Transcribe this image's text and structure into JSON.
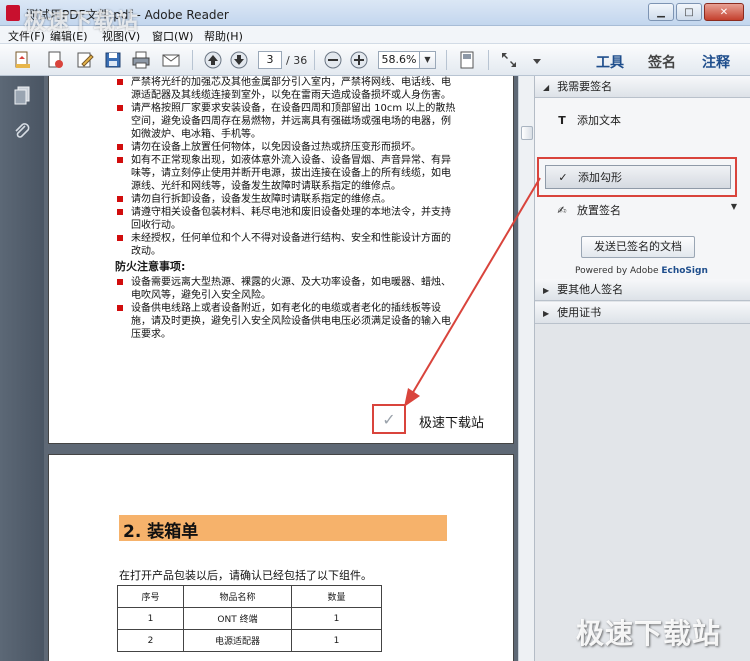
{
  "window": {
    "title": "测试用PDF文件.pdf - Adobe Reader",
    "minimize": "▁",
    "maximize": "□",
    "close": "✕"
  },
  "menu": {
    "items": [
      "文件(F)",
      "编辑(E)",
      "视图(V)",
      "窗口(W)",
      "帮助(H)"
    ]
  },
  "toolbar": {
    "page_current": "3",
    "page_total": "/ 36",
    "zoom": "58.6%",
    "zoom_dropdown": "▼",
    "tabs": {
      "tools": "工具",
      "sign": "签名",
      "comment": "注释"
    }
  },
  "document": {
    "bullets": [
      "严禁将光纤的加强芯及其他金属部分引入室内，严禁将网线、电话线、电源适配器及其线缆连接到室外，以免在雷雨天造成设备损坏或人身伤害。",
      "请严格按照厂家要求安装设备，在设备四周和顶部留出 10cm 以上的散热空间，避免设备四周存在易燃物，并远离具有强磁场或强电场的电器，例如微波炉、电冰箱、手机等。",
      "请勿在设备上放置任何物体，以免因设备过热或挤压变形而损坏。",
      "如有不正常现象出现，如液体意外流入设备、设备冒烟、声音异常、有异味等，请立刻停止使用并断开电源，拔出连接在设备上的所有线缆，如电源线、光纤和网线等，设备发生故障时请联系指定的维修点。",
      "请勿自行拆卸设备，设备发生故障时请联系指定的维修点。",
      "请遵守相关设备包装材料、耗尽电池和废旧设备处理的本地法令，并支持回收行动。",
      "未经授权，任何单位和个人不得对设备进行结构、安全和性能设计方面的改动。"
    ],
    "fire_heading": "防火注意事项:",
    "fire_bullets": [
      "设备需要远离大型热源、裸露的火源、及大功率设备，如电暖器、蜡烛、电吹风等，避免引入安全风险。",
      "设备供电线路上或者设备附近，如有老化的电缆或者老化的插线板等设施，请及时更换，避免引入安全风险设备供电电压必须满足设备的输入电压要求。"
    ],
    "checkmark": "✓",
    "check_caption": "极速下载站",
    "section_title": "2.  装箱单",
    "section_intro": "在打开产品包装以后，请确认已经包括了以下组件。",
    "table": {
      "headers": [
        "序号",
        "物品名称",
        "数量"
      ],
      "rows": [
        [
          "1",
          "ONT 终端",
          "1"
        ],
        [
          "2",
          "电源适配器",
          "1"
        ]
      ]
    }
  },
  "sign_panel": {
    "section1": "我需要签名",
    "items": {
      "add_text": "添加文本",
      "add_check": "添加勾形",
      "place_sig": "放置签名"
    },
    "send_button": "发送已签名的文档",
    "powered_prefix": "Powered by Adobe ",
    "powered_brand": "EchoSign",
    "section2": "要其他人签名",
    "section3": "使用证书",
    "expanded_tri": "◢",
    "collapsed_tri": "▶"
  },
  "watermark": {
    "top": "极速下载站",
    "bottom": "极速下载站"
  },
  "colors": {
    "highlight_red": "#d9443c",
    "bullet_red": "#d10d0d",
    "section_orange": "#f6b26b",
    "tab_blue": "#1f4e8c"
  }
}
